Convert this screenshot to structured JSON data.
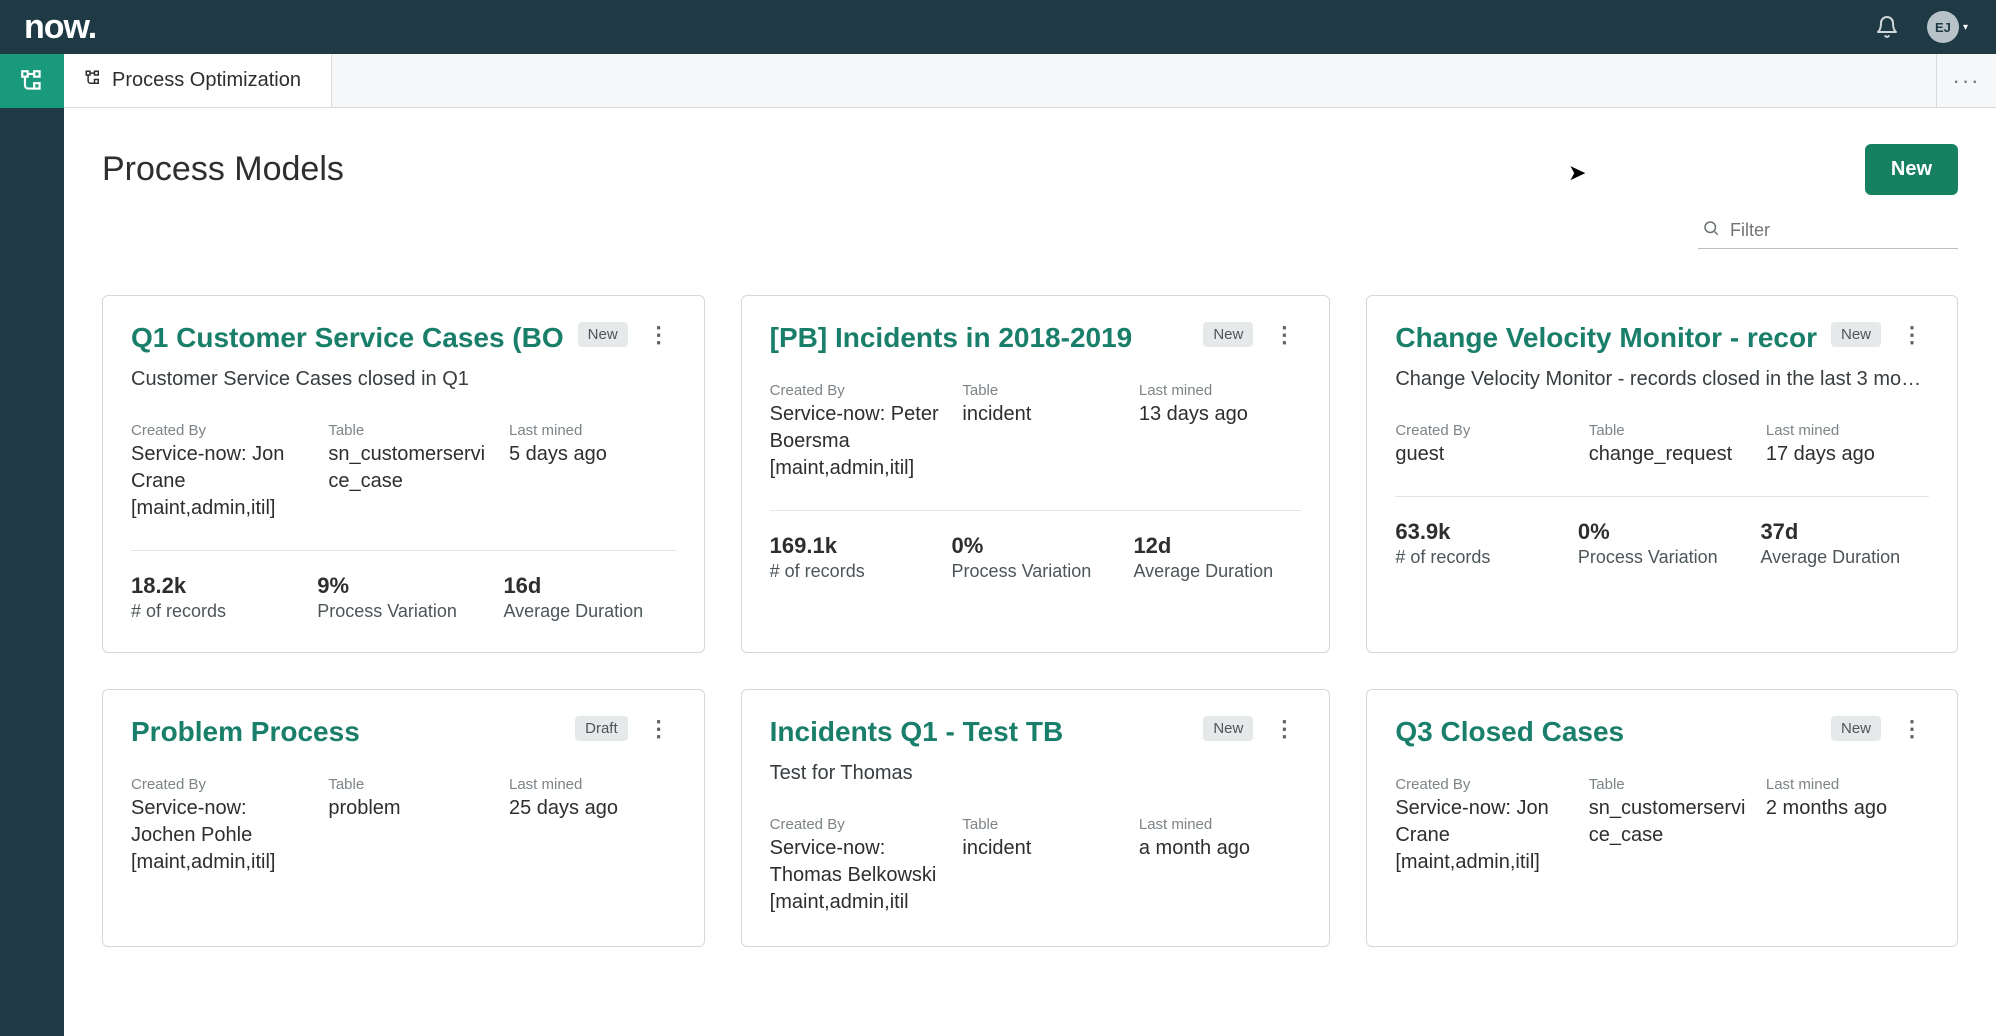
{
  "brand": {
    "logo_text": "now."
  },
  "avatar": {
    "initials": "EJ"
  },
  "tab": {
    "label": "Process Optimization"
  },
  "page": {
    "title": "Process Models",
    "new_button": "New",
    "filter_placeholder": "Filter"
  },
  "labels": {
    "created_by": "Created By",
    "table": "Table",
    "last_mined": "Last mined",
    "records": "# of records",
    "variation": "Process Variation",
    "avg_duration": "Average Duration"
  },
  "cards": [
    {
      "title": "Q1 Customer Service Cases (BO",
      "badge": "New",
      "desc": "Customer Service Cases closed in Q1",
      "created_by": "Service-now: Jon Crane [maint,admin,itil]",
      "table": "sn_customerservice_case",
      "last_mined": "5 days ago",
      "records": "18.2k",
      "variation": "9%",
      "avg_duration": "16d"
    },
    {
      "title": "[PB] Incidents in 2018-2019",
      "badge": "New",
      "desc": "",
      "created_by": "Service-now: Peter Boersma [maint,admin,itil]",
      "table": "incident",
      "last_mined": "13 days ago",
      "records": "169.1k",
      "variation": "0%",
      "avg_duration": "12d"
    },
    {
      "title": "Change Velocity Monitor - recor",
      "badge": "New",
      "desc": "Change Velocity Monitor - records closed in the last 3 mo…",
      "created_by": "guest",
      "table": "change_request",
      "last_mined": "17 days ago",
      "records": "63.9k",
      "variation": "0%",
      "avg_duration": "37d"
    },
    {
      "title": "Problem Process",
      "badge": "Draft",
      "desc": "",
      "created_by": "Service-now: Jochen Pohle [maint,admin,itil]",
      "table": "problem",
      "last_mined": "25 days ago",
      "records": "",
      "variation": "",
      "avg_duration": ""
    },
    {
      "title": "Incidents Q1 - Test TB",
      "badge": "New",
      "desc": "Test for Thomas",
      "created_by": "Service-now: Thomas Belkowski [maint,admin,itil",
      "table": "incident",
      "last_mined": "a month ago",
      "records": "",
      "variation": "",
      "avg_duration": ""
    },
    {
      "title": "Q3 Closed Cases",
      "badge": "New",
      "desc": "",
      "created_by": "Service-now: Jon Crane [maint,admin,itil]",
      "table": "sn_customerservice_case",
      "last_mined": "2 months ago",
      "records": "",
      "variation": "",
      "avg_duration": ""
    }
  ]
}
